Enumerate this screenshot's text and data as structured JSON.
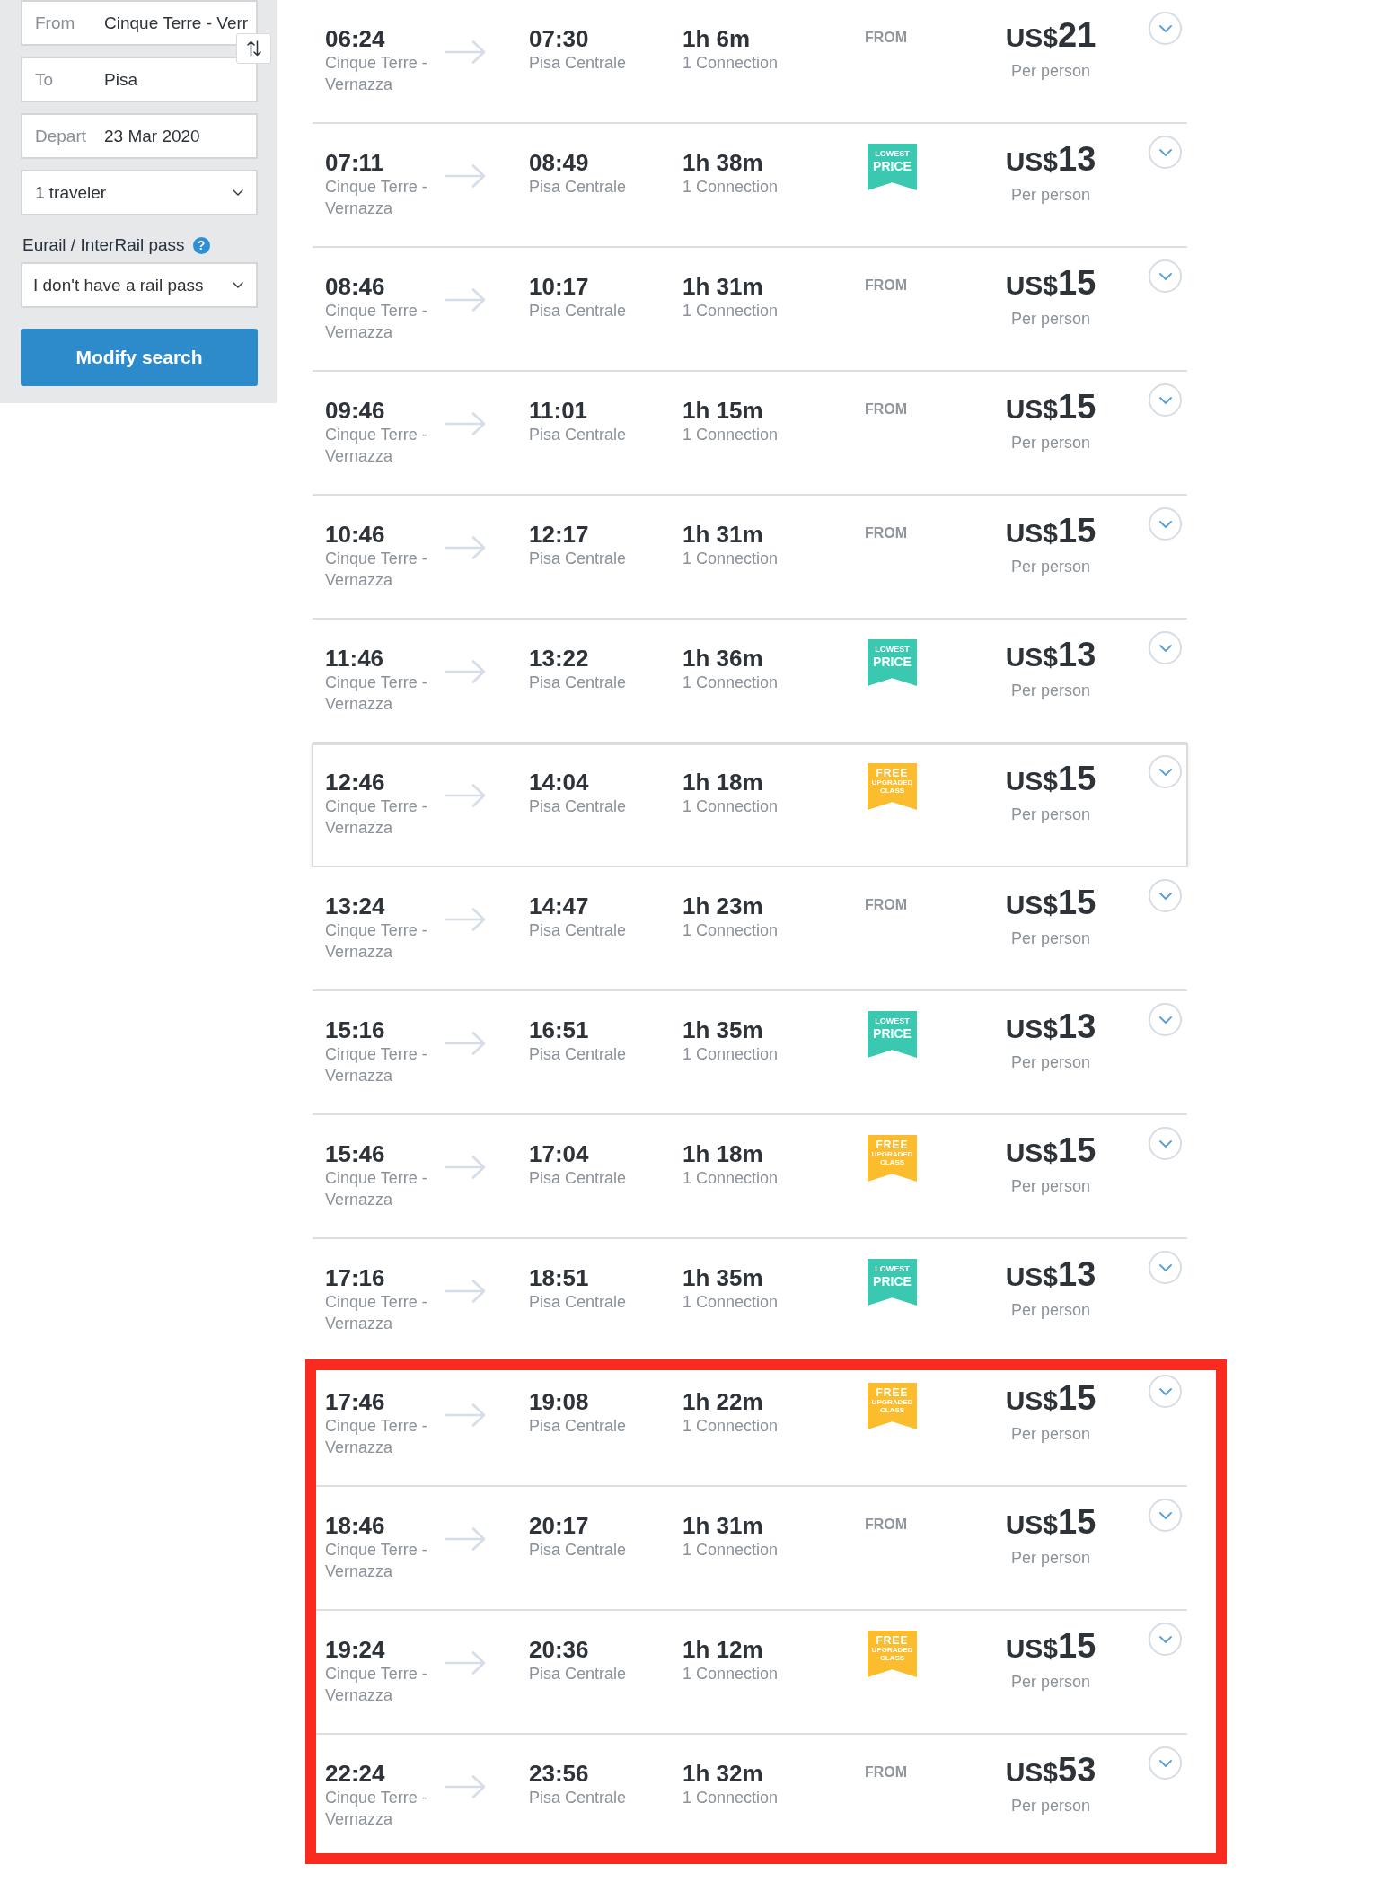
{
  "search_form": {
    "from": {
      "label": "From",
      "value": "Cinque Terre - Verr"
    },
    "to": {
      "label": "To",
      "value": "Pisa"
    },
    "depart": {
      "label": "Depart",
      "value": "23 Mar 2020"
    },
    "travelers": {
      "value": "1 traveler"
    },
    "rail_pass": {
      "label": "Eurail / InterRail pass",
      "help": "?",
      "value": "I don't have a rail pass"
    },
    "submit": "Modify search"
  },
  "results": [
    {
      "departure": "06:24",
      "origin": "Cinque Terre - Vernazza",
      "arrival": "07:30",
      "destination": "Pisa Centrale",
      "duration": "1h 6m",
      "connections": "1 Connection",
      "tag": {
        "kind": "from",
        "text": "FROM"
      },
      "price": {
        "currency": "US$",
        "amount": "21",
        "note": "Per person"
      },
      "highlighted": false,
      "annotated": false
    },
    {
      "departure": "07:11",
      "origin": "Cinque Terre - Vernazza",
      "arrival": "08:49",
      "destination": "Pisa Centrale",
      "duration": "1h 38m",
      "connections": "1 Connection",
      "tag": {
        "kind": "lowest-price",
        "lines": [
          "LOWEST",
          "PRICE"
        ]
      },
      "price": {
        "currency": "US$",
        "amount": "13",
        "note": "Per person"
      },
      "highlighted": false,
      "annotated": false
    },
    {
      "departure": "08:46",
      "origin": "Cinque Terre - Vernazza",
      "arrival": "10:17",
      "destination": "Pisa Centrale",
      "duration": "1h 31m",
      "connections": "1 Connection",
      "tag": {
        "kind": "from",
        "text": "FROM"
      },
      "price": {
        "currency": "US$",
        "amount": "15",
        "note": "Per person"
      },
      "highlighted": false,
      "annotated": false
    },
    {
      "departure": "09:46",
      "origin": "Cinque Terre - Vernazza",
      "arrival": "11:01",
      "destination": "Pisa Centrale",
      "duration": "1h 15m",
      "connections": "1 Connection",
      "tag": {
        "kind": "from",
        "text": "FROM"
      },
      "price": {
        "currency": "US$",
        "amount": "15",
        "note": "Per person"
      },
      "highlighted": false,
      "annotated": false
    },
    {
      "departure": "10:46",
      "origin": "Cinque Terre - Vernazza",
      "arrival": "12:17",
      "destination": "Pisa Centrale",
      "duration": "1h 31m",
      "connections": "1 Connection",
      "tag": {
        "kind": "from",
        "text": "FROM"
      },
      "price": {
        "currency": "US$",
        "amount": "15",
        "note": "Per person"
      },
      "highlighted": false,
      "annotated": false
    },
    {
      "departure": "11:46",
      "origin": "Cinque Terre - Vernazza",
      "arrival": "13:22",
      "destination": "Pisa Centrale",
      "duration": "1h 36m",
      "connections": "1 Connection",
      "tag": {
        "kind": "lowest-price",
        "lines": [
          "LOWEST",
          "PRICE"
        ]
      },
      "price": {
        "currency": "US$",
        "amount": "13",
        "note": "Per person"
      },
      "highlighted": false,
      "annotated": false
    },
    {
      "departure": "12:46",
      "origin": "Cinque Terre - Vernazza",
      "arrival": "14:04",
      "destination": "Pisa Centrale",
      "duration": "1h 18m",
      "connections": "1 Connection",
      "tag": {
        "kind": "free-upgrade",
        "lines": [
          "FREE",
          "UPGRADED",
          "CLASS"
        ]
      },
      "price": {
        "currency": "US$",
        "amount": "15",
        "note": "Per person"
      },
      "highlighted": true,
      "annotated": false
    },
    {
      "departure": "13:24",
      "origin": "Cinque Terre - Vernazza",
      "arrival": "14:47",
      "destination": "Pisa Centrale",
      "duration": "1h 23m",
      "connections": "1 Connection",
      "tag": {
        "kind": "from",
        "text": "FROM"
      },
      "price": {
        "currency": "US$",
        "amount": "15",
        "note": "Per person"
      },
      "highlighted": false,
      "annotated": false
    },
    {
      "departure": "15:16",
      "origin": "Cinque Terre - Vernazza",
      "arrival": "16:51",
      "destination": "Pisa Centrale",
      "duration": "1h 35m",
      "connections": "1 Connection",
      "tag": {
        "kind": "lowest-price",
        "lines": [
          "LOWEST",
          "PRICE"
        ]
      },
      "price": {
        "currency": "US$",
        "amount": "13",
        "note": "Per person"
      },
      "highlighted": false,
      "annotated": false
    },
    {
      "departure": "15:46",
      "origin": "Cinque Terre - Vernazza",
      "arrival": "17:04",
      "destination": "Pisa Centrale",
      "duration": "1h 18m",
      "connections": "1 Connection",
      "tag": {
        "kind": "free-upgrade",
        "lines": [
          "FREE",
          "UPGRADED",
          "CLASS"
        ]
      },
      "price": {
        "currency": "US$",
        "amount": "15",
        "note": "Per person"
      },
      "highlighted": false,
      "annotated": false
    },
    {
      "departure": "17:16",
      "origin": "Cinque Terre - Vernazza",
      "arrival": "18:51",
      "destination": "Pisa Centrale",
      "duration": "1h 35m",
      "connections": "1 Connection",
      "tag": {
        "kind": "lowest-price",
        "lines": [
          "LOWEST",
          "PRICE"
        ]
      },
      "price": {
        "currency": "US$",
        "amount": "13",
        "note": "Per person"
      },
      "highlighted": false,
      "annotated": false
    },
    {
      "departure": "17:46",
      "origin": "Cinque Terre - Vernazza",
      "arrival": "19:08",
      "destination": "Pisa Centrale",
      "duration": "1h 22m",
      "connections": "1 Connection",
      "tag": {
        "kind": "free-upgrade",
        "lines": [
          "FREE",
          "UPGRADED",
          "CLASS"
        ]
      },
      "price": {
        "currency": "US$",
        "amount": "15",
        "note": "Per person"
      },
      "highlighted": false,
      "annotated": true
    },
    {
      "departure": "18:46",
      "origin": "Cinque Terre - Vernazza",
      "arrival": "20:17",
      "destination": "Pisa Centrale",
      "duration": "1h 31m",
      "connections": "1 Connection",
      "tag": {
        "kind": "from",
        "text": "FROM"
      },
      "price": {
        "currency": "US$",
        "amount": "15",
        "note": "Per person"
      },
      "highlighted": false,
      "annotated": true
    },
    {
      "departure": "19:24",
      "origin": "Cinque Terre - Vernazza",
      "arrival": "20:36",
      "destination": "Pisa Centrale",
      "duration": "1h 12m",
      "connections": "1 Connection",
      "tag": {
        "kind": "free-upgrade",
        "lines": [
          "FREE",
          "UPGRADED",
          "CLASS"
        ]
      },
      "price": {
        "currency": "US$",
        "amount": "15",
        "note": "Per person"
      },
      "highlighted": false,
      "annotated": true
    },
    {
      "departure": "22:24",
      "origin": "Cinque Terre - Vernazza",
      "arrival": "23:56",
      "destination": "Pisa Centrale",
      "duration": "1h 32m",
      "connections": "1 Connection",
      "tag": {
        "kind": "from",
        "text": "FROM"
      },
      "price": {
        "currency": "US$",
        "amount": "53",
        "note": "Per person"
      },
      "highlighted": false,
      "annotated": true
    }
  ]
}
